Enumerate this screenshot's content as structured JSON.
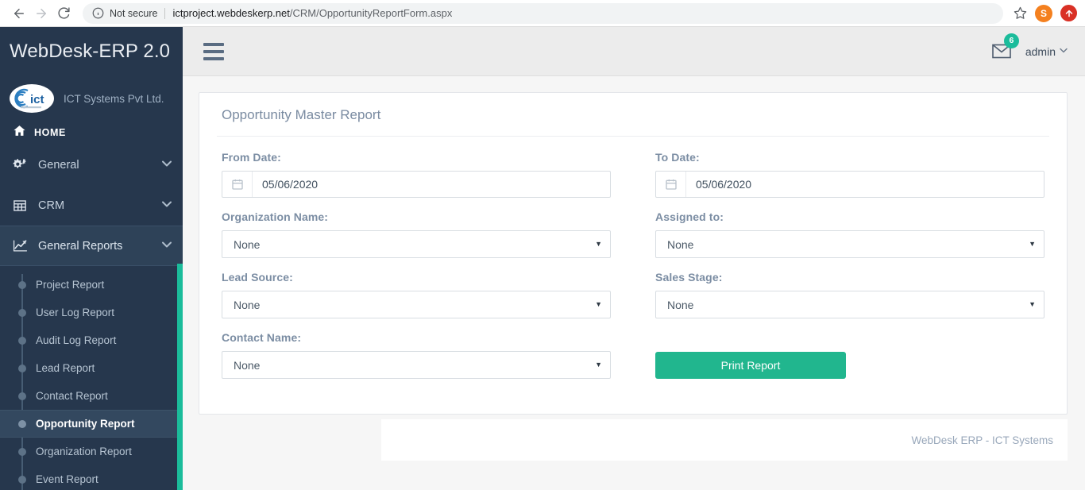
{
  "browser": {
    "back_icon": "arrow-left-icon",
    "forward_icon": "arrow-right-icon",
    "reload_icon": "reload-icon",
    "security_label": "Not secure",
    "url_host": "ictproject.webdeskerp.net",
    "url_path": "/CRM/OpportunityReportForm.aspx",
    "bookmark_icon": "star-icon",
    "profile_initial": "S",
    "extension_icon": "upload-arrow-icon"
  },
  "sidebar": {
    "brand": "WebDesk-ERP 2.0",
    "logo_text": "ict",
    "company": "ICT Systems Pvt Ltd.",
    "home": {
      "label": "HOME",
      "icon": "home-icon"
    },
    "menu": [
      {
        "label": "General",
        "icon": "gears-icon",
        "caret": "❯",
        "active": false
      },
      {
        "label": "CRM",
        "icon": "table-grid-icon",
        "caret": "❯",
        "active": false
      },
      {
        "label": "General Reports",
        "icon": "line-chart-icon",
        "caret": "❯",
        "active": true
      }
    ],
    "submenu": [
      {
        "label": "Project Report",
        "active": false
      },
      {
        "label": "User Log Report",
        "active": false
      },
      {
        "label": "Audit Log Report",
        "active": false
      },
      {
        "label": "Lead Report",
        "active": false
      },
      {
        "label": "Contact Report",
        "active": false
      },
      {
        "label": "Opportunity Report",
        "active": true
      },
      {
        "label": "Organization Report",
        "active": false
      },
      {
        "label": "Event Report",
        "active": false
      }
    ],
    "accent_color": "#1bbc9b"
  },
  "topbar": {
    "menu_toggle_icon": "hamburger-icon",
    "mail_icon": "envelope-icon",
    "mail_count": "6",
    "user": "admin",
    "user_caret": "⌄"
  },
  "page": {
    "title": "Opportunity Master Report",
    "fields": {
      "from_date": {
        "label": "From Date:",
        "value": "05/06/2020",
        "placeholder": "mm/dd/yyyy",
        "icon": "calendar-icon"
      },
      "to_date": {
        "label": "To Date:",
        "value": "05/06/2020",
        "placeholder": "mm/dd/yyyy",
        "icon": "calendar-icon"
      },
      "organization_name": {
        "label": "Organization Name:",
        "value": "None"
      },
      "assigned_to": {
        "label": "Assigned to:",
        "value": "None"
      },
      "lead_source": {
        "label": "Lead Source:",
        "value": "None"
      },
      "sales_stage": {
        "label": "Sales Stage:",
        "value": "None"
      },
      "contact_name": {
        "label": "Contact Name:",
        "value": "None"
      }
    },
    "print_button": "Print Report",
    "select_arrow": "▼"
  },
  "footer": {
    "text": "WebDesk ERP - ICT Systems"
  },
  "colors": {
    "sidebar_bg": "#26374d",
    "accent": "#1bbc9b",
    "button": "#21b68e",
    "topbar_bg": "#ececec"
  }
}
